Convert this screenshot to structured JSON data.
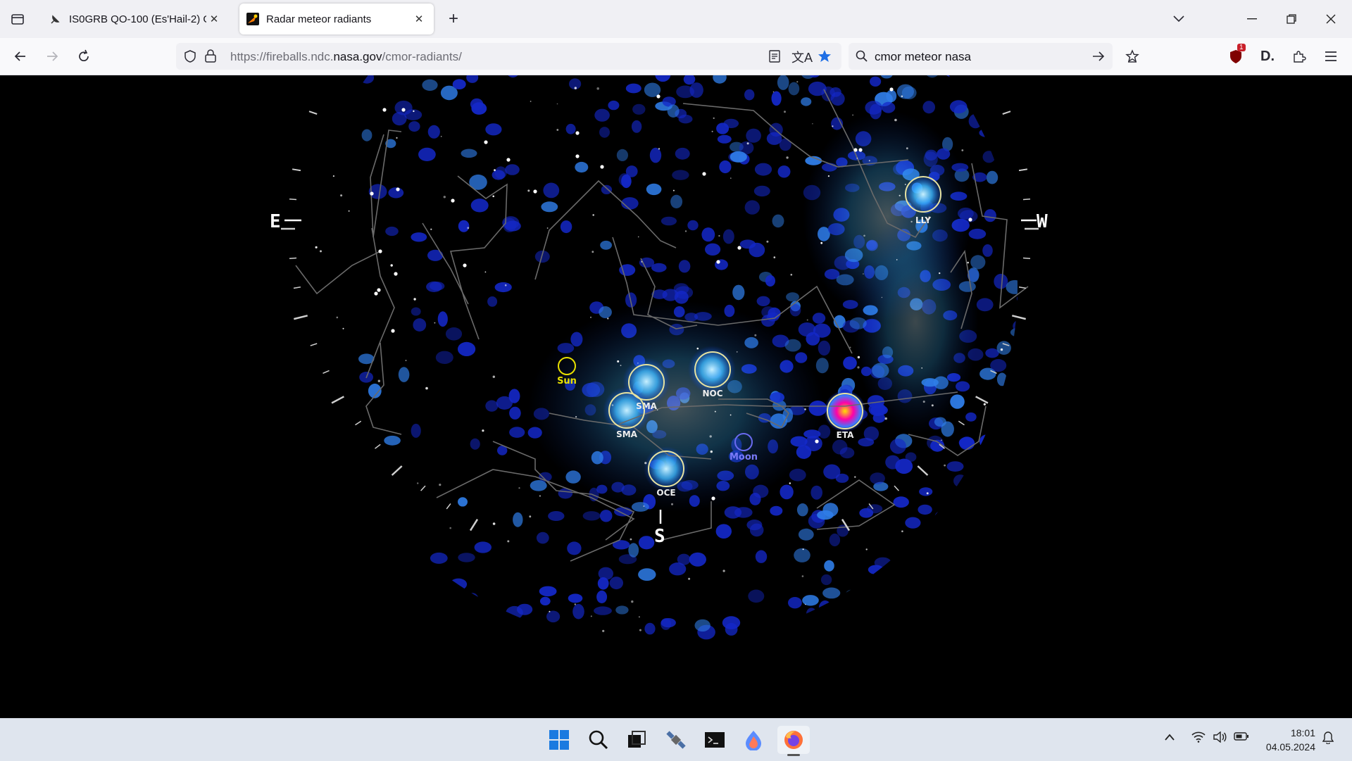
{
  "browser": {
    "tabs": [
      {
        "title": "IS0GRB QO-100 (Es'Hail-2) Geo",
        "active": false
      },
      {
        "title": "Radar meteor radiants",
        "active": true
      }
    ],
    "url_prefix": "https://fireballs.ndc.",
    "url_domain": "nasa.gov",
    "url_path": "/cmor-radiants/",
    "search_query": "cmor meteor nasa",
    "extension_badge": "1"
  },
  "skymap": {
    "directions": {
      "east": "E",
      "west": "W",
      "south": "S"
    },
    "markers": [
      {
        "label": "Sun",
        "color": "#e8e000"
      },
      {
        "label": "Moon",
        "color": "#6a6af0"
      }
    ],
    "showers": [
      {
        "code": "LLY"
      },
      {
        "code": "SMA"
      },
      {
        "code": "NOC"
      },
      {
        "code": "SMA"
      },
      {
        "code": "ETA"
      },
      {
        "code": "OCE"
      }
    ]
  },
  "system": {
    "time": "18:01",
    "date": "04.05.2024"
  },
  "colors": {
    "accent_star": "#1f6fe5",
    "badge": "#c9202a"
  }
}
